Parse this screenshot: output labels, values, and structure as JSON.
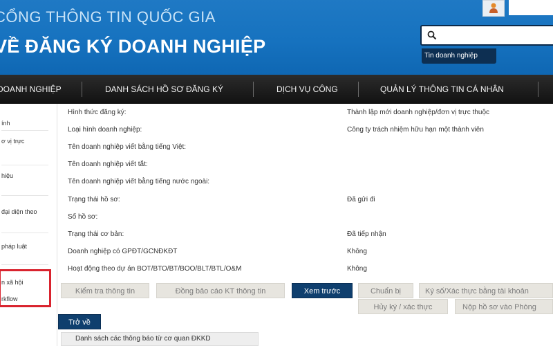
{
  "header": {
    "line1": "CỔNG THÔNG TIN QUỐC GIA",
    "line2": "VỀ ĐĂNG KÝ DOANH NGHIỆP",
    "search_placeholder": "",
    "search_tab": "Tin doanh nghiệp"
  },
  "nav": {
    "items": [
      {
        "label": "DOANH NGHIỆP"
      },
      {
        "label": "DANH SÁCH HỒ SƠ ĐĂNG KÝ"
      },
      {
        "label": "DỊCH VỤ CÔNG"
      },
      {
        "label": "QUẢN LÝ THÔNG TIN CÁ NHÂN"
      }
    ]
  },
  "sidebar": {
    "items": [
      {
        "label": "ính"
      },
      {
        "label": "ơ vị trực"
      },
      {
        "label": "hiệu"
      },
      {
        "label": "đại diện theo"
      },
      {
        "label": "pháp luật"
      },
      {
        "label": "n xã hội"
      },
      {
        "label": "rkflow"
      }
    ]
  },
  "details": {
    "rows": [
      {
        "label": "Hình thức đăng ký:",
        "value": "Thành lập mới doanh nghiệp/đơn vị trực thuộc"
      },
      {
        "label": "Loại hình doanh nghiệp:",
        "value": "Công ty trách nhiệm hữu hạn một thành viên"
      },
      {
        "label": "Tên doanh nghiệp viết bằng tiếng Việt:",
        "value": ""
      },
      {
        "label": "Tên doanh nghiệp viết tắt:",
        "value": ""
      },
      {
        "label": "Tên doanh nghiệp viết bằng tiếng nước ngoài:",
        "value": ""
      },
      {
        "label": "Trạng thái hồ sơ:",
        "value": "Đã gửi đi"
      },
      {
        "label": "Số hồ sơ:",
        "value": ""
      },
      {
        "label": "Trạng thái cơ bản:",
        "value": "Đã tiếp nhận"
      },
      {
        "label": "Doanh nghiệp có GPĐT/GCNĐKĐT",
        "value": "Không"
      },
      {
        "label": "Hoạt động theo dự án BOT/BTO/BT/BOO/BLT/BTL/O&M",
        "value": "Không"
      }
    ]
  },
  "actions": {
    "check_info": "Kiểm tra thông tin",
    "sync_report": "Đồng bảo cáo KT thông tin",
    "preview": "Xem trước",
    "prepare": "Chuẩn bị",
    "sign_verify": "Ký số/Xác thực bằng tài khoản",
    "cancel_sign": "Hủy ký / xác thực",
    "submit_room": "Nộp hồ sơ vào Phòng",
    "back": "Trở về"
  },
  "notice": {
    "label": "Danh sách các thông báo từ cơ quan ĐKKD"
  },
  "colors": {
    "header_blue": "#1672bf",
    "nav_black": "#1a1a1a",
    "button_dark": "#0f3f6e",
    "highlight_red": "#d9232e"
  }
}
